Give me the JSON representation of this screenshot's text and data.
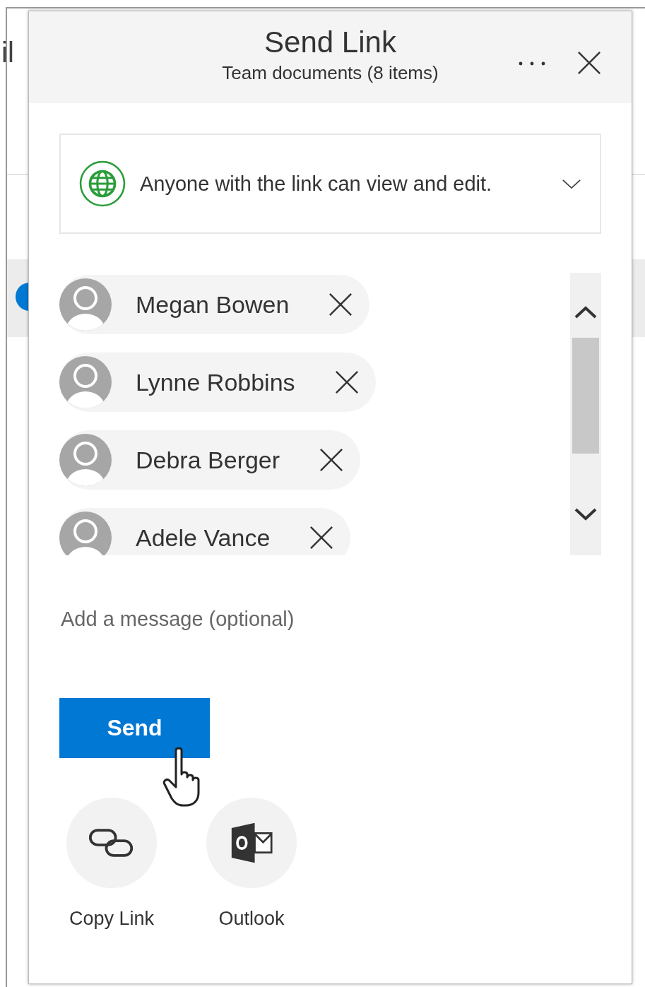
{
  "background": {
    "label": "il"
  },
  "dialog": {
    "title": "Send Link",
    "subtitle": "Team documents (8 items)"
  },
  "link_settings": {
    "text": "Anyone with the link can view and edit."
  },
  "recipients": [
    {
      "name": "Megan Bowen"
    },
    {
      "name": "Lynne Robbins"
    },
    {
      "name": "Debra Berger"
    },
    {
      "name": "Adele Vance"
    }
  ],
  "message": {
    "placeholder": "Add a message (optional)"
  },
  "send_button": {
    "label": "Send"
  },
  "share_options": [
    {
      "kind": "copy_link",
      "label": "Copy Link"
    },
    {
      "kind": "outlook",
      "label": "Outlook"
    }
  ]
}
